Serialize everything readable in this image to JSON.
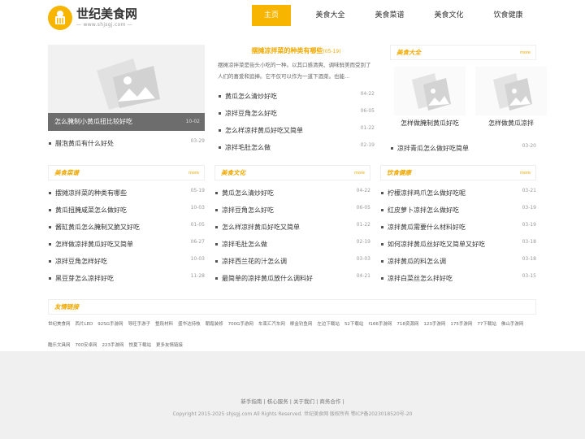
{
  "header": {
    "logo_title": "世纪美食网",
    "logo_sub": "www.shjsgj.com",
    "nav": [
      {
        "label": "主页",
        "active": true
      },
      {
        "label": "美食大全"
      },
      {
        "label": "美食菜谱"
      },
      {
        "label": "美食文化"
      },
      {
        "label": "饮食健康"
      }
    ]
  },
  "feature": {
    "caption": "怎么腌制小黄瓜扭比较好吃",
    "date": "10-02",
    "list": [
      {
        "title": "腊泡黄瓜有什么好处",
        "date": "03-29"
      }
    ]
  },
  "headline": {
    "title": "摆摊凉拌菜的种类有哪些",
    "date": "(05-19)",
    "summary": "摆摊凉拌菜是街头小吃的一种。以其口感清爽、调味鲜美而受到了人们的喜爱和追捧。它不仅可以作为一道下酒菜。也能..."
  },
  "middle_list": [
    {
      "title": "黄瓜怎么清炒好吃",
      "date": "04-22"
    },
    {
      "title": "凉拌豆角怎么好吃",
      "date": "06-05"
    },
    {
      "title": "怎么样凉拌黄瓜好吃又简单",
      "date": "01-22"
    },
    {
      "title": "凉拌毛肚怎么做",
      "date": "02-19"
    }
  ],
  "meishi_daquan": {
    "title": "美食大全",
    "more": "more",
    "thumbs": [
      "怎样做腌制黄瓜好吃",
      "怎样做黄瓜凉拌"
    ],
    "list": [
      {
        "title": "凉拌青瓜怎么做好吃简单",
        "date": "03-20"
      }
    ]
  },
  "box_caipu": {
    "title": "美食菜谱",
    "more": "more",
    "items": [
      {
        "title": "摆摊凉拌菜的种类有哪些",
        "date": "05-19"
      },
      {
        "title": "黄瓜扭腌咸菜怎么做好吃",
        "date": "10-03"
      },
      {
        "title": "酱缸黄瓜怎么腌制又脆又好吃",
        "date": "01-05"
      },
      {
        "title": "怎样做凉拌黄瓜好吃又简单",
        "date": "06-27"
      },
      {
        "title": "凉拌豆角怎样好吃",
        "date": "10-03"
      },
      {
        "title": "黑豆芽怎么凉拌好吃",
        "date": "11-28"
      }
    ]
  },
  "box_wenhua": {
    "title": "美食文化",
    "more": "more",
    "items": [
      {
        "title": "黄瓜怎么清炒好吃",
        "date": "04-22"
      },
      {
        "title": "凉拌豆角怎么好吃",
        "date": "06-05"
      },
      {
        "title": "怎么样凉拌黄瓜好吃又简单",
        "date": "01-22"
      },
      {
        "title": "凉拌毛肚怎么做",
        "date": "02-19"
      },
      {
        "title": "凉拌西兰花的汁怎么调",
        "date": "03-03"
      },
      {
        "title": "最简单的凉拌黄瓜放什么调料好",
        "date": "04-21"
      }
    ]
  },
  "box_jiankang": {
    "title": "饮食健康",
    "more": "more",
    "items": [
      {
        "title": "柠檬凉拌鸡爪怎么做好吃呢",
        "date": "03-21"
      },
      {
        "title": "红皮萝卜凉拌怎么做好吃",
        "date": "03-19"
      },
      {
        "title": "凉拌黄瓜需要什么材料好吃",
        "date": "03-19"
      },
      {
        "title": "如何凉拌黄瓜丝好吃又简单又好吃",
        "date": "03-18"
      },
      {
        "title": "凉拌黄瓜的料怎么调",
        "date": "03-18"
      },
      {
        "title": "凉拌白菜丝怎么拌好吃",
        "date": "03-15"
      }
    ]
  },
  "friend_links": {
    "title": "友情链接",
    "items": [
      "世纪美食网",
      "西片LED",
      "92SG手游网",
      "导旺手游子",
      "整段材料",
      "盛华达持枝",
      "朝霞装修",
      "700G手游网",
      "车束汇汽车网",
      "柳金钓鱼网",
      "左边下载站",
      "52下载站",
      "f166手游网",
      "718资源网",
      "123手游网",
      "175手游网",
      "77下载站",
      "佛山手游网",
      "酷乐文具网",
      "700安卓网",
      "223手游网",
      "悦夏下载站",
      "更多友情链接"
    ]
  },
  "footer": {
    "nav": "新手指南 | 核心服务 | 关于我们 | 商务合作 |",
    "copyright": "Copyright 2015-2025 shjsgj.com All Rights Reserved. 世纪美食网 版权所有 鄂ICP备2023018520号-20"
  },
  "colors": {
    "accent": "#f7b500",
    "accent_text": "#f0a800",
    "footer_bg": "#f0f0f0"
  }
}
